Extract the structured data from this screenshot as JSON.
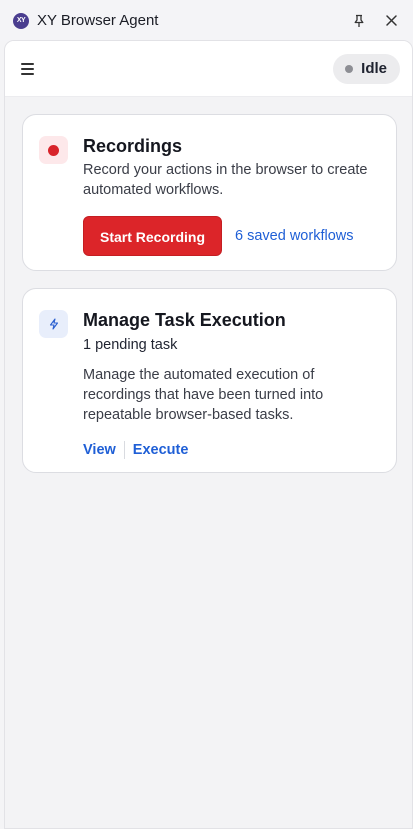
{
  "window": {
    "title": "XY Browser Agent",
    "logo_text": "XY"
  },
  "header": {
    "status": "Idle",
    "status_color": "#8d8e94"
  },
  "recordings_card": {
    "title": "Recordings",
    "description": "Record your actions in the browser to create automated workflows.",
    "button_label": "Start Recording",
    "saved_link": "6 saved workflows",
    "accent": "#dc2529"
  },
  "tasks_card": {
    "title": "Manage Task Execution",
    "pending": "1 pending task",
    "description": "Manage the automated execution of recordings that have been turned into repeatable browser-based tasks.",
    "view_label": "View",
    "execute_label": "Execute",
    "link_color": "#1f5fd6"
  }
}
